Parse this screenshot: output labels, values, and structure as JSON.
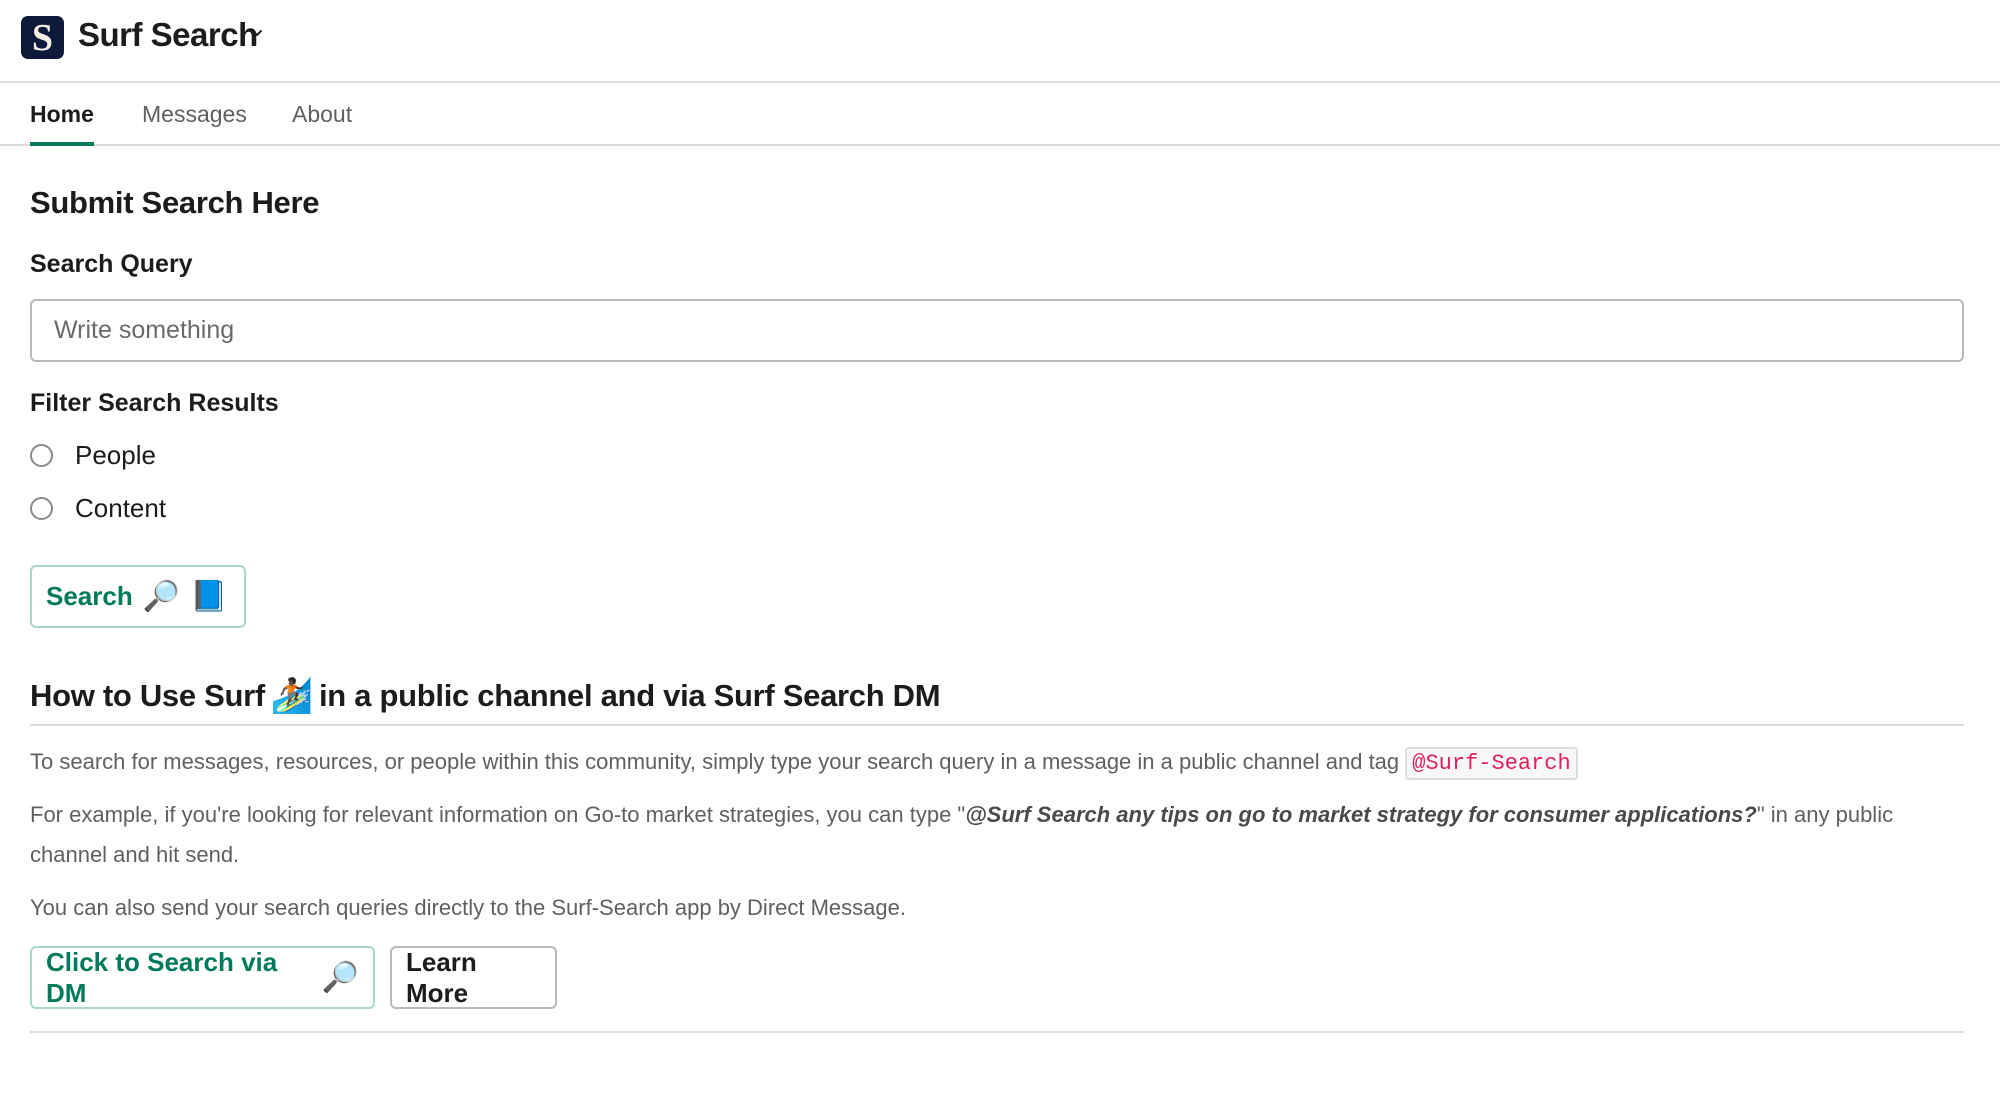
{
  "header": {
    "logo_letter": "S",
    "app_name": "Surf Search",
    "brand_color": "#0e1a3a",
    "accent_color": "#007a5a"
  },
  "tabs": [
    {
      "label": "Home",
      "active": true
    },
    {
      "label": "Messages",
      "active": false
    },
    {
      "label": "About",
      "active": false
    }
  ],
  "form": {
    "title": "Submit Search Here",
    "query_label": "Search Query",
    "query_placeholder": "Write something",
    "query_value": "",
    "filter_label": "Filter Search Results",
    "filter_options": [
      {
        "label": "People",
        "selected": false
      },
      {
        "label": "Content",
        "selected": false
      }
    ],
    "search_button": {
      "label": "Search",
      "emoji_1": "🔎",
      "emoji_2": "📘"
    }
  },
  "howto": {
    "title_before": "How to Use Surf",
    "title_emoji": "🏄🏿",
    "title_after": "in a public channel and via Surf Search DM",
    "para1_text": "To search for messages, resources, or people within this community, simply type your search query in a message in a public channel and tag ",
    "para1_code": "@Surf-Search",
    "para2_before": "For example, if you're looking for relevant information on Go-to market strategies, you can type \"",
    "para2_emphasis": "@Surf Search any tips on go to market strategy for consumer applications?",
    "para2_after": "\" in any public channel and hit send.",
    "para3_text": "You can also send your search queries directly to the Surf-Search app by Direct Message.",
    "dm_button": {
      "label": "Click to Search via DM",
      "emoji": "🔎"
    },
    "learn_more_button": {
      "label": "Learn More"
    }
  }
}
